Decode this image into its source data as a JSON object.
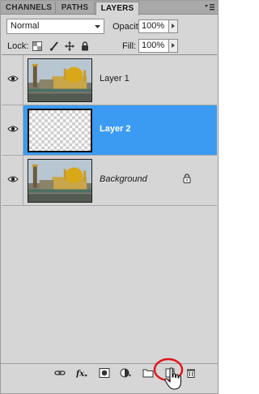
{
  "tabs": [
    {
      "label": "CHANNELS"
    },
    {
      "label": "PATHS"
    },
    {
      "label": "LAYERS"
    }
  ],
  "blend_mode": {
    "value": "Normal"
  },
  "opacity": {
    "label": "Opacity:",
    "value": "100%"
  },
  "lock": {
    "label": "Lock:"
  },
  "fill": {
    "label": "Fill:",
    "value": "100%"
  },
  "layers": [
    {
      "name": "Layer 1",
      "visible": true,
      "selected": false,
      "thumbnail": "mosque-photo"
    },
    {
      "name": "Layer 2",
      "visible": true,
      "selected": true,
      "thumbnail": "transparent-checkerboard"
    },
    {
      "name": "Background",
      "visible": true,
      "selected": false,
      "thumbnail": "mosque-photo",
      "locked": true
    }
  ],
  "bottom_icons": [
    "link-layers-icon",
    "layer-style-fx-icon",
    "add-mask-icon",
    "adjustment-layer-icon",
    "new-group-icon",
    "new-layer-icon",
    "delete-layer-icon"
  ],
  "colors": {
    "selection": "#3b9bf3",
    "highlight_circle": "#e0161b"
  }
}
